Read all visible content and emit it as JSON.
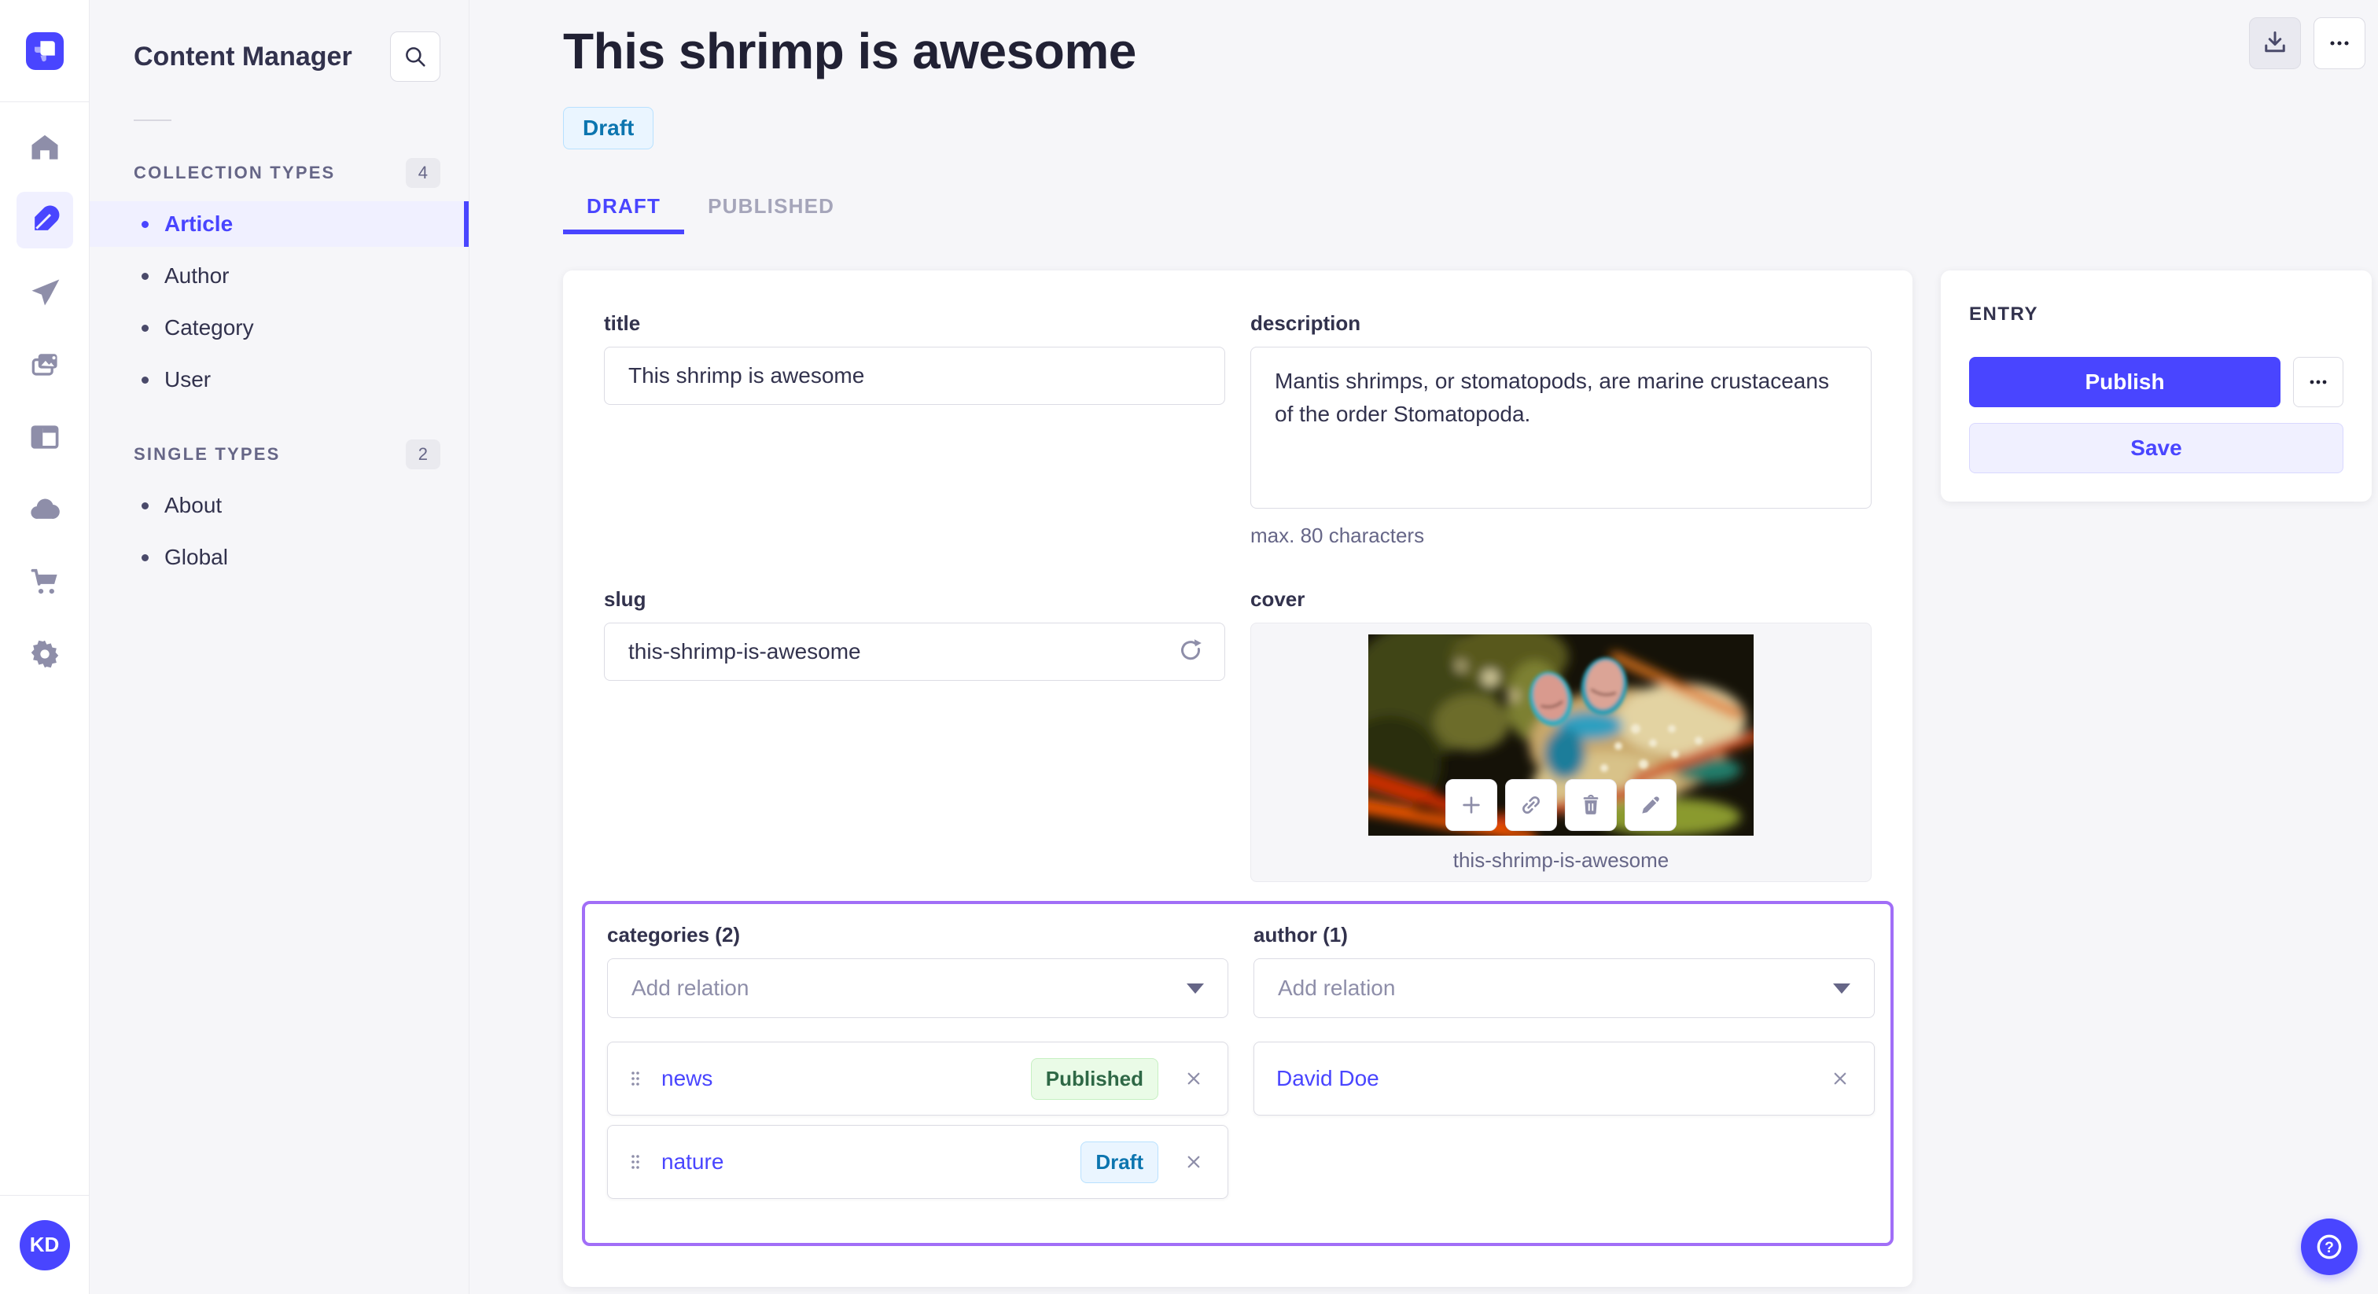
{
  "app": {
    "brand_color": "#4945ff",
    "avatar_initials": "KD",
    "nav_rail_icons": [
      {
        "name": "home-icon",
        "active": false
      },
      {
        "name": "feather-icon",
        "active": true
      },
      {
        "name": "paper-plane-icon",
        "active": false
      },
      {
        "name": "media-library-icon",
        "active": false
      },
      {
        "name": "layout-icon",
        "active": false
      },
      {
        "name": "cloud-icon",
        "active": false
      },
      {
        "name": "cart-icon",
        "active": false
      },
      {
        "name": "gear-icon",
        "active": false
      }
    ],
    "help_icon": "question-mark-circle-icon"
  },
  "sidebar": {
    "title": "Content Manager",
    "search_icon": "search-icon",
    "sections": [
      {
        "label": "COLLECTION TYPES",
        "count": "4",
        "items": [
          {
            "label": "Article"
          },
          {
            "label": "Author"
          },
          {
            "label": "Category"
          },
          {
            "label": "User"
          }
        ]
      },
      {
        "label": "SINGLE TYPES",
        "count": "2",
        "items": [
          {
            "label": "About"
          },
          {
            "label": "Global"
          }
        ]
      }
    ]
  },
  "header": {
    "title": "This shrimp is awesome",
    "status_badge": "Draft",
    "action_icons": [
      "download-icon",
      "more-dots-icon"
    ]
  },
  "tabs": [
    {
      "label": "DRAFT"
    },
    {
      "label": "PUBLISHED"
    }
  ],
  "form": {
    "title_field": {
      "label": "title",
      "value": "This shrimp is awesome"
    },
    "description_field": {
      "label": "description",
      "value": "Mantis shrimps, or stomatopods, are marine crustaceans of the order Stomatopoda.",
      "hint": "max. 80 characters"
    },
    "slug_field": {
      "label": "slug",
      "value": "this-shrimp-is-awesome",
      "icon": "refresh-icon"
    },
    "cover_field": {
      "label": "cover",
      "filename": "this-shrimp-is-awesome",
      "action_icons": [
        "plus-icon",
        "link-icon",
        "trash-icon",
        "pencil-icon"
      ]
    },
    "categories_field": {
      "label": "categories (2)",
      "placeholder": "Add relation",
      "items": [
        {
          "name": "news",
          "status": "Published"
        },
        {
          "name": "nature",
          "status": "Draft"
        }
      ]
    },
    "author_field": {
      "label": "author (1)",
      "placeholder": "Add relation",
      "items": [
        {
          "name": "David Doe"
        }
      ]
    }
  },
  "entry_panel": {
    "title": "ENTRY",
    "publish_label": "Publish",
    "save_label": "Save"
  },
  "colors": {
    "brand": "#4945ff",
    "draft_badge_text": "#0c75af",
    "published_badge_text": "#2f6846",
    "relations_outline": "#a16ef7"
  }
}
